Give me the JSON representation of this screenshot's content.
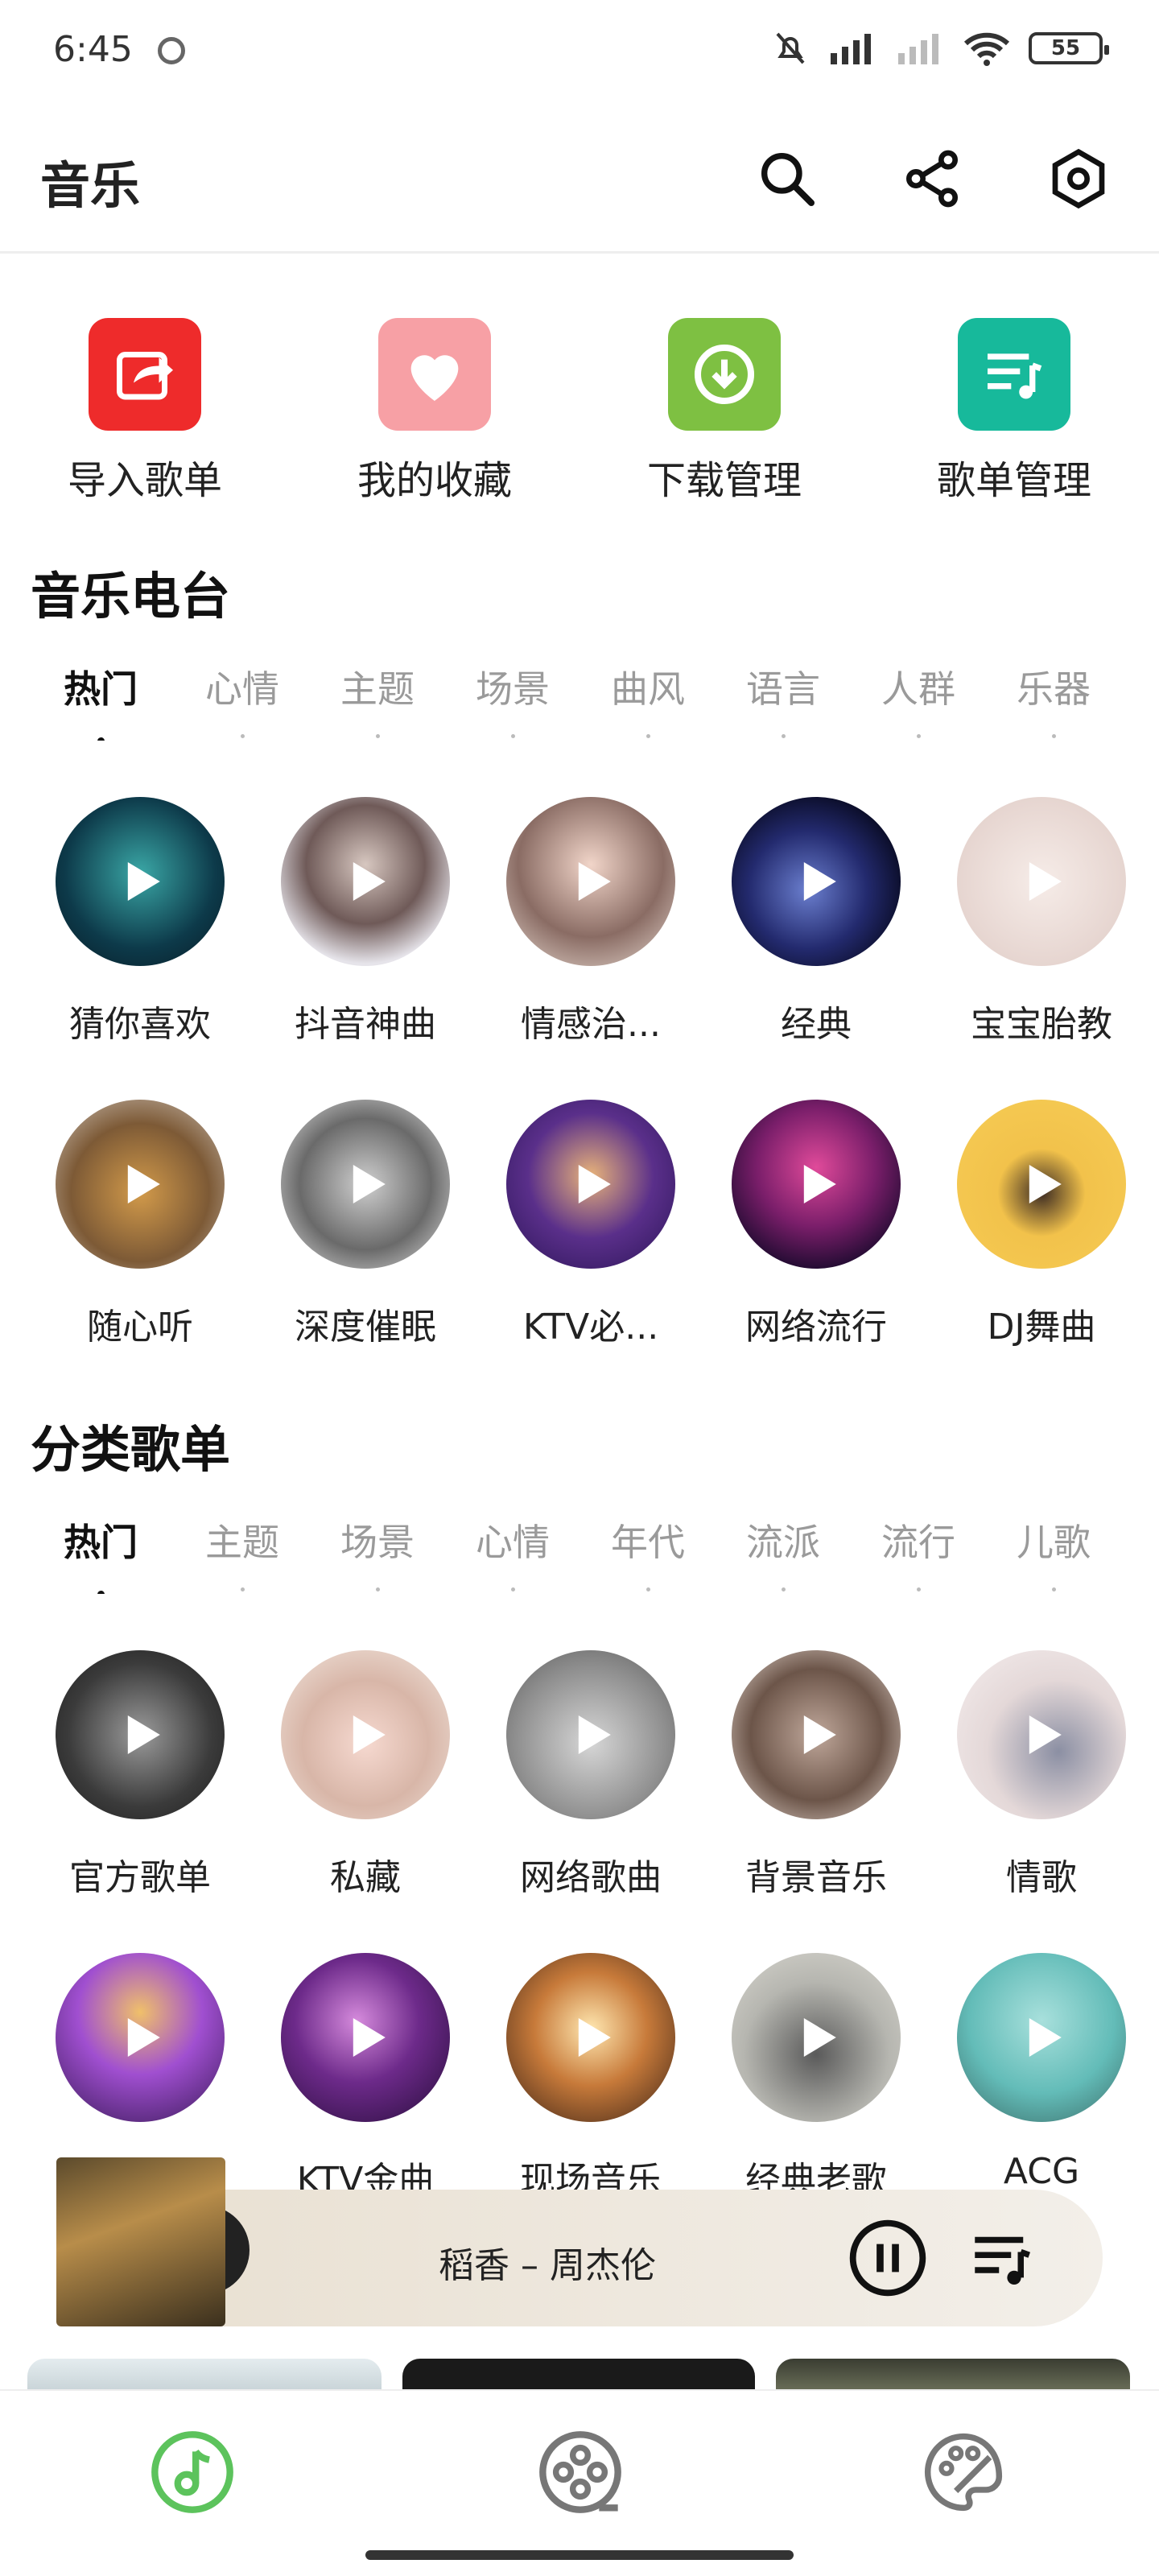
{
  "status": {
    "time": "6:45",
    "battery": "55"
  },
  "header": {
    "title": "音乐"
  },
  "shortcuts": [
    {
      "label": "导入歌单",
      "icon": "import-playlist-icon",
      "color": "#ee2b2b"
    },
    {
      "label": "我的收藏",
      "icon": "heart-icon",
      "color": "#f7a0a5"
    },
    {
      "label": "下载管理",
      "icon": "download-icon",
      "color": "#7ec042"
    },
    {
      "label": "歌单管理",
      "icon": "playlist-icon",
      "color": "#17b99b"
    }
  ],
  "radio": {
    "title": "音乐电台",
    "tabs": [
      "热门",
      "心情",
      "主题",
      "场景",
      "曲风",
      "语言",
      "人群",
      "乐器"
    ],
    "items": [
      "猜你喜欢",
      "抖音神曲",
      "情感治...",
      "经典",
      "宝宝胎教",
      "随心听",
      "深度催眠",
      "KTV必...",
      "网络流行",
      "DJ舞曲"
    ]
  },
  "category": {
    "title": "分类歌单",
    "tabs": [
      "热门",
      "主题",
      "场景",
      "心情",
      "年代",
      "流派",
      "流行",
      "儿歌"
    ],
    "items": [
      "官方歌单",
      "私藏",
      "网络歌曲",
      "背景音乐",
      "情歌",
      "",
      "KTV金曲",
      "现场音乐",
      "经典老歌",
      "ACG"
    ]
  },
  "player": {
    "now_playing": "稻香 – 周杰伦"
  },
  "colors": {
    "accent": "#5cc35c"
  }
}
